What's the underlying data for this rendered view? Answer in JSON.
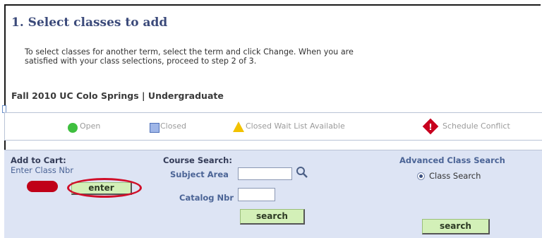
{
  "header": {
    "step_title": "1.  Select classes to add"
  },
  "instructions": {
    "line1": "To select classes for another term, select the term and click Change.  When you are",
    "line2": "satisfied with your class selections, proceed to step 2 of 3."
  },
  "term": {
    "label": "Fall 2010 UC Colo Springs | Undergraduate"
  },
  "legend": {
    "open": "Open",
    "closed": "Closed",
    "wait_list": "Closed Wait List Available",
    "conflict": "Schedule Conflict"
  },
  "add_to_cart": {
    "title": "Add to Cart:",
    "subtitle": "Enter Class Nbr",
    "enter_label": "enter"
  },
  "course_search": {
    "title": "Course Search:",
    "subject_label": "Subject Area",
    "catalog_label": "Catalog Nbr",
    "search_label": "search"
  },
  "advanced": {
    "title": "Advanced Class Search",
    "radio_label": "Class Search",
    "search_label": "search"
  },
  "colors": {
    "accent": "#3b4a7a",
    "panel_bg": "#dde4f4",
    "button_bg": "#d3f0b8",
    "highlight_red": "#d0102a"
  }
}
